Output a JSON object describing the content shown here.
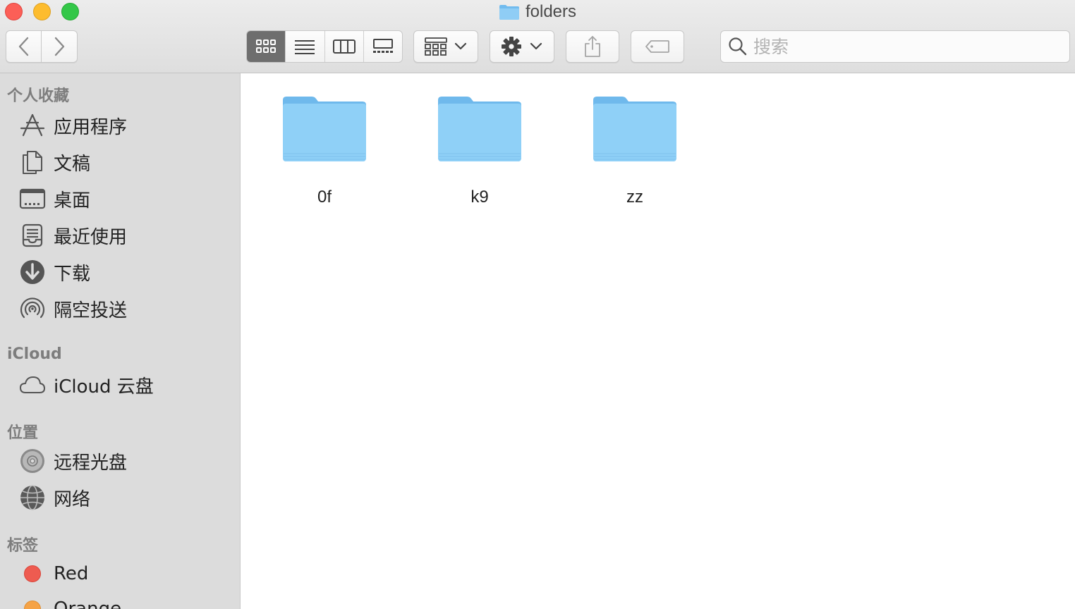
{
  "window": {
    "title": "folders"
  },
  "toolbar": {
    "search_placeholder": "搜索"
  },
  "sidebar": {
    "favorites_title": "个人收藏",
    "favorites": [
      {
        "label": "应用程序",
        "icon": "applications-icon"
      },
      {
        "label": "文稿",
        "icon": "documents-icon"
      },
      {
        "label": "桌面",
        "icon": "desktop-icon"
      },
      {
        "label": "最近使用",
        "icon": "recents-icon"
      },
      {
        "label": "下载",
        "icon": "downloads-icon"
      },
      {
        "label": "隔空投送",
        "icon": "airdrop-icon"
      }
    ],
    "icloud_title": "iCloud",
    "icloud": [
      {
        "label": "iCloud 云盘",
        "icon": "cloud-icon"
      }
    ],
    "locations_title": "位置",
    "locations": [
      {
        "label": "远程光盘",
        "icon": "remote-disc-icon"
      },
      {
        "label": "网络",
        "icon": "network-icon"
      }
    ],
    "tags_title": "标签",
    "tags": [
      {
        "label": "Red",
        "color": "#ee5b50"
      },
      {
        "label": "Orange",
        "color": "#f5a347"
      }
    ]
  },
  "content": {
    "folders": [
      {
        "name": "0f"
      },
      {
        "name": "k9"
      },
      {
        "name": "zz"
      }
    ]
  },
  "colors": {
    "folder_blue": "#7fc4f0",
    "active_view": "#6e6e6e"
  }
}
